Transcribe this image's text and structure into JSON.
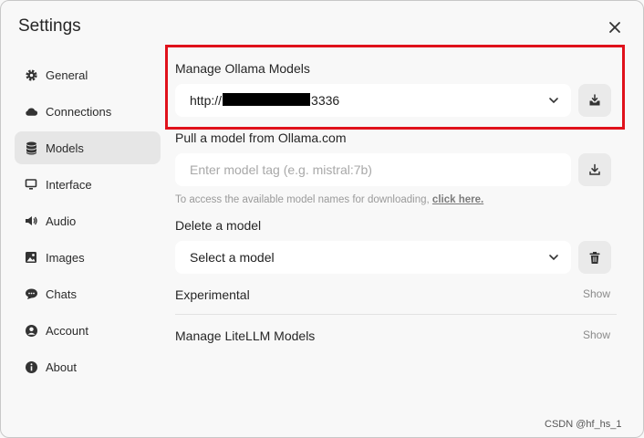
{
  "dialog": {
    "title": "Settings"
  },
  "sidebar": {
    "items": [
      {
        "label": "General",
        "icon": "gear-icon",
        "active": false
      },
      {
        "label": "Connections",
        "icon": "cloud-icon",
        "active": false
      },
      {
        "label": "Models",
        "icon": "database-icon",
        "active": true
      },
      {
        "label": "Interface",
        "icon": "monitor-icon",
        "active": false
      },
      {
        "label": "Audio",
        "icon": "speaker-icon",
        "active": false
      },
      {
        "label": "Images",
        "icon": "image-icon",
        "active": false
      },
      {
        "label": "Chats",
        "icon": "chat-bubble-icon",
        "active": false
      },
      {
        "label": "Account",
        "icon": "user-circle-icon",
        "active": false
      },
      {
        "label": "About",
        "icon": "info-icon",
        "active": false
      }
    ]
  },
  "manage_ollama": {
    "label": "Manage Ollama Models",
    "url_prefix": "http://",
    "url_suffix": "3336"
  },
  "pull_model": {
    "label": "Pull a model from Ollama.com",
    "placeholder": "Enter model tag (e.g. mistral:7b)",
    "hint_text": "To access the available model names for downloading, ",
    "hint_link": "click here."
  },
  "delete_model": {
    "label": "Delete a model",
    "select_value": "Select a model"
  },
  "experimental": {
    "label": "Experimental",
    "toggle": "Show"
  },
  "litellm": {
    "label": "Manage LiteLLM Models",
    "toggle": "Show"
  },
  "watermark": "CSDN @hf_hs_1",
  "colors": {
    "highlight": "#e0111b",
    "active_bg": "#e6e6e6",
    "page_bg": "#f8f8f8"
  }
}
